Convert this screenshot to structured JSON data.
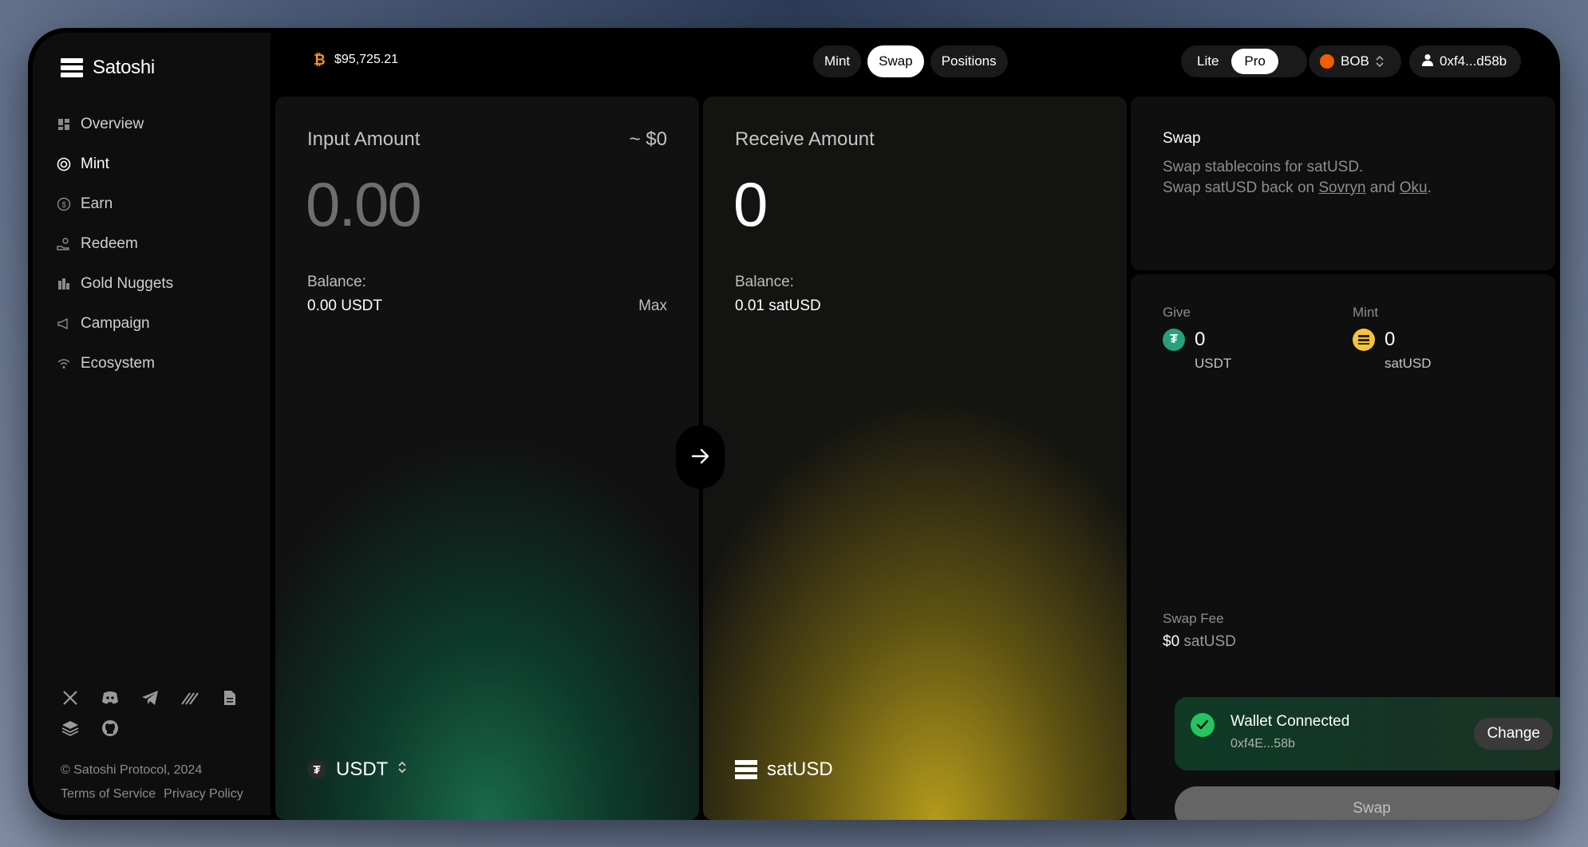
{
  "brand": {
    "name": "Satoshi",
    "icon": "satoshi-logo-icon"
  },
  "sidebar": {
    "items": [
      {
        "label": "Overview",
        "icon": "grid-icon"
      },
      {
        "label": "Mint",
        "icon": "target-icon",
        "active": true
      },
      {
        "label": "Earn",
        "icon": "dollar-circle-icon"
      },
      {
        "label": "Redeem",
        "icon": "hand-coins-icon"
      },
      {
        "label": "Gold Nuggets",
        "icon": "bars-icon"
      },
      {
        "label": "Campaign",
        "icon": "megaphone-icon"
      },
      {
        "label": "Ecosystem",
        "icon": "wifi-icon"
      }
    ],
    "socials": [
      "x-icon",
      "discord-icon",
      "telegram-icon",
      "lines-icon",
      "document-icon",
      "layers-icon",
      "github-icon"
    ],
    "copyright": "© Satoshi Protocol, 2024",
    "terms": "Terms of Service",
    "privacy": "Privacy Policy"
  },
  "header": {
    "btc_price": "$95,725.21",
    "tabs": [
      {
        "label": "Mint"
      },
      {
        "label": "Swap",
        "active": true
      },
      {
        "label": "Positions"
      }
    ],
    "mode": {
      "lite": "Lite",
      "pro": "Pro",
      "selected": "Pro"
    },
    "network": "BOB",
    "account": "0xf4...d58b"
  },
  "input_panel": {
    "label": "Input Amount",
    "approx": "~ $0",
    "amount": "0.00",
    "balance_label": "Balance:",
    "balance": "0.00 USDT",
    "max": "Max",
    "token": "USDT"
  },
  "receive_panel": {
    "label": "Receive Amount",
    "amount": "0",
    "balance_label": "Balance:",
    "balance": "0.01 satUSD",
    "token": "satUSD"
  },
  "info": {
    "title": "Swap",
    "line1": "Swap stablecoins for satUSD.",
    "line2_prefix": "Swap satUSD back on ",
    "link1": "Sovryn",
    "line2_mid": " and ",
    "link2": "Oku",
    "line2_suffix": "."
  },
  "summary": {
    "give_label": "Give",
    "give_amount": "0",
    "give_token": "USDT",
    "mint_label": "Mint",
    "mint_amount": "0",
    "mint_token": "satUSD",
    "fee_label": "Swap Fee",
    "fee_amount": "$0",
    "fee_token": "satUSD"
  },
  "wallet": {
    "title": "Wallet Connected",
    "address": "0xf4E...58b",
    "change": "Change"
  },
  "swap_button": "Swap",
  "colors": {
    "usdt": "#26a17b",
    "satusd": "#f4c33f",
    "bob": "#f25d00",
    "btc": "#f7931a",
    "connected": "#22c55e"
  }
}
